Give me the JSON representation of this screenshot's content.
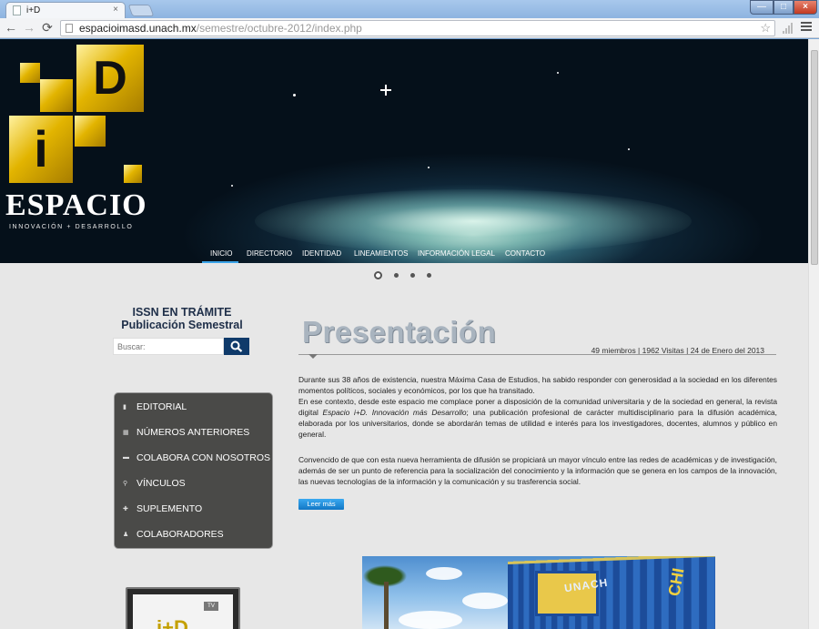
{
  "browser": {
    "tab_title": "i+D",
    "tab_close": "×",
    "window_controls": {
      "minimize": "—",
      "maximize": "□",
      "close": "×"
    },
    "nav": {
      "back": "←",
      "forward": "→",
      "reload": "⟳"
    },
    "url": {
      "domain": "espacioimasd.unach.mx",
      "path": "/semestre/octubre-2012/index.php"
    },
    "star": "☆"
  },
  "banner": {
    "logo_word": "ESPACIO",
    "logo_sub": "INNOVACIÓN + DESARROLLO",
    "logo_letter_d": "D",
    "logo_letter_i": "i",
    "nav": [
      "INICIO",
      "DIRECTORIO",
      "IDENTIDAD",
      "LINEAMIENTOS",
      "INFORMACIÓN LEGAL",
      "CONTACTO"
    ],
    "active_nav": "INICIO",
    "slides_total": 4,
    "slide_active": 1
  },
  "sidebar": {
    "issn_line1": "ISSN EN TRÁMITE",
    "issn_line2": "Publicación Semestral",
    "search_placeholder": "Buscar:",
    "menu": [
      {
        "icon": "document-icon",
        "glyph": "▮",
        "label": "EDITORIAL"
      },
      {
        "icon": "stack-icon",
        "glyph": "▦",
        "label": "NÚMEROS ANTERIORES"
      },
      {
        "icon": "email-icon",
        "glyph": "▬",
        "label": "COLABORA CON NOSOTROS"
      },
      {
        "icon": "link-icon",
        "glyph": "⚲",
        "label": "VÍNCULOS"
      },
      {
        "icon": "plus-icon",
        "glyph": "✚",
        "label": "SUPLEMENTO"
      },
      {
        "icon": "person-icon",
        "glyph": "♟",
        "label": "COLABORADORES"
      }
    ],
    "tv_logo": {
      "text": "i+D",
      "badge": "TV"
    }
  },
  "main": {
    "title": "Presentación",
    "meta": "49 miembros | 1962 Visitas | 24 de Enero del 2013",
    "p1": "Durante sus 38 años de existencia, nuestra Máxima Casa de Estudios, ha sabido responder con generosidad a la sociedad en los diferentes momentos políticos, sociales y económicos, por los que ha transitado.",
    "p2_before": "En ese contexto, desde este espacio me complace poner a disposición de la comunidad universitaria y de la sociedad en general, la revista digital ",
    "p2_italic": "Espacio i+D. Innovación más Desarrollo",
    "p2_after": "; una publicación profesional de carácter multidisciplinario para la difusión académica, elaborada por los universitarios, donde se abordarán temas de utilidad e interés para los investigadores, docentes, alumnos y público en general.",
    "p3": "Convencido de que con esta nueva herramienta de difusión se propiciará un mayor vínculo entre las redes de académicas y de investigación, además de ser un punto de referencia para la socialización del conocimiento y la información que se genera en los campos de la innovación, las nuevas tecnologías de la información y la comunicación y su trasferencia social.",
    "read_more": "Leer más",
    "photo_text_1": "UNACH",
    "photo_text_2": "CHI"
  },
  "colors": {
    "accent_blue": "#3aa3e8",
    "menu_bg": "#4a4a48",
    "search_btn": "#0f3a6a",
    "gold": "#e2b400"
  }
}
